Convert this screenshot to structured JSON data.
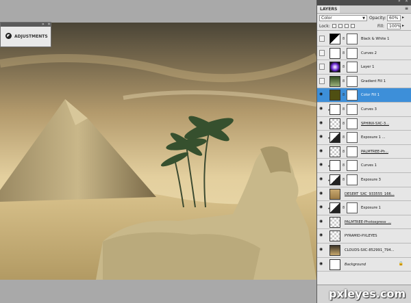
{
  "adjustments": {
    "title": "ADJUSTMENTS"
  },
  "layers_panel": {
    "tab": "LAYERS",
    "blend_mode": "Color",
    "opacity_label": "Opacity:",
    "opacity_value": "60%",
    "lock_label": "Lock:",
    "fill_label": "Fill:",
    "fill_value": "100%",
    "layers": [
      {
        "name": "Black & White 1",
        "visible": false,
        "clipped": false,
        "thumb": "adjustment-bw",
        "mask": true,
        "selected": false
      },
      {
        "name": "Curves 2",
        "visible": false,
        "clipped": false,
        "thumb": "adjustment-curves",
        "mask": true,
        "selected": false
      },
      {
        "name": "Layer 1",
        "visible": false,
        "clipped": false,
        "thumb": "purple-glow",
        "mask": true,
        "selected": false
      },
      {
        "name": "Gradient Fill 1",
        "visible": false,
        "clipped": false,
        "thumb": "gradient",
        "mask": true,
        "selected": false
      },
      {
        "name": "Color Fill 1",
        "visible": true,
        "clipped": false,
        "thumb": "olive-fill",
        "mask": true,
        "selected": true
      },
      {
        "name": "Curves 3",
        "visible": true,
        "clipped": true,
        "thumb": "adjustment-curves",
        "mask": true,
        "selected": false
      },
      {
        "name": "SPHINX-SXC-3...",
        "visible": true,
        "clipped": false,
        "thumb": "sphinx",
        "mask": true,
        "selected": false,
        "underline": true
      },
      {
        "name": "Exposure 1 ...",
        "visible": true,
        "clipped": true,
        "thumb": "adjustment-exposure",
        "mask": true,
        "selected": false
      },
      {
        "name": "PALMTREE-Ph...",
        "visible": true,
        "clipped": false,
        "thumb": "palm",
        "mask": true,
        "selected": false,
        "underline": true
      },
      {
        "name": "Curves 1",
        "visible": true,
        "clipped": true,
        "thumb": "adjustment-curves",
        "mask": true,
        "selected": false
      },
      {
        "name": "Exposure 3",
        "visible": true,
        "clipped": true,
        "thumb": "adjustment-exposure",
        "mask": true,
        "selected": false
      },
      {
        "name": "DESERT_SXC_933555_166...",
        "visible": true,
        "clipped": false,
        "thumb": "desert",
        "mask": false,
        "selected": false,
        "underline": true
      },
      {
        "name": "Exposure 1",
        "visible": true,
        "clipped": true,
        "thumb": "adjustment-exposure",
        "mask": true,
        "selected": false
      },
      {
        "name": "PALMTREE-Photoxpress_...",
        "visible": true,
        "clipped": false,
        "thumb": "palm",
        "mask": false,
        "selected": false,
        "underline": true
      },
      {
        "name": "PYRAMID-PXLEYES",
        "visible": true,
        "clipped": false,
        "thumb": "pyramid",
        "mask": false,
        "selected": false
      },
      {
        "name": "CLOUDS-SXC-852991_794...",
        "visible": true,
        "clipped": false,
        "thumb": "clouds",
        "mask": false,
        "selected": false
      },
      {
        "name": "Background",
        "visible": true,
        "clipped": false,
        "thumb": "white",
        "mask": false,
        "selected": false,
        "italic": true,
        "locked": true
      }
    ]
  },
  "watermark": "pxleyes.com",
  "colors": {
    "selection": "#3d8fd9",
    "panel_bg": "#e6e6e6",
    "sky": "#d8b67a"
  }
}
